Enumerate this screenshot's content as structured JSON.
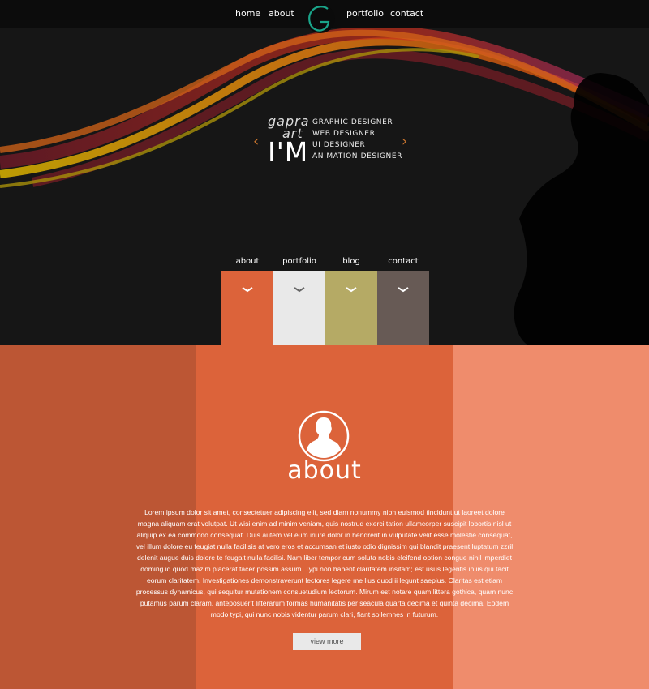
{
  "top_nav": {
    "items": [
      {
        "label": "home"
      },
      {
        "label": "about"
      },
      {
        "label": "portfolio"
      },
      {
        "label": "contact"
      }
    ],
    "logo_letter": "G"
  },
  "hero": {
    "brand_small_line1": "gapra",
    "brand_small_line2": "art",
    "brand_big": "I'M",
    "roles": [
      "GRAPHIC DESIGNER",
      "WEB DESIGNER",
      "UI DESIGNER",
      "ANIMATION DESIGNER"
    ],
    "prev_arrow": "‹",
    "next_arrow": "›"
  },
  "sections": [
    {
      "label": "about",
      "color": "#dc633a"
    },
    {
      "label": "portfolio",
      "color": "#e9e9e9"
    },
    {
      "label": "blog",
      "color": "#b5aa65"
    },
    {
      "label": "contact",
      "color": "#675a55"
    }
  ],
  "about": {
    "title": "about",
    "body": "Lorem ipsum dolor sit amet, consectetuer adipiscing elit, sed diam nonummy nibh euismod tincidunt ut laoreet dolore magna aliquam erat volutpat. Ut wisi enim ad minim veniam, quis nostrud exerci tation ullamcorper suscipit lobortis nisl ut aliquip ex ea commodo consequat. Duis autem vel eum iriure dolor in hendrerit in vulputate velit esse molestie consequat, vel illum dolore eu feugiat nulla facilisis at vero eros et accumsan et iusto odio dignissim qui blandit praesent luptatum zzril delenit augue duis dolore te feugait nulla facilisi. Nam liber tempor cum soluta nobis eleifend option congue nihil imperdiet doming id quod mazim placerat facer possim assum. Typi non habent claritatem insitam; est usus legentis in iis qui facit eorum claritatem. Investigationes demonstraverunt lectores legere me lius quod ii legunt saepius. Claritas est etiam processus dynamicus, qui sequitur mutationem consuetudium lectorum. Mirum est notare quam littera gothica, quam nunc putamus parum claram, anteposuerit litterarum formas humanitatis per seacula quarta decima et quinta decima. Eodem modo typi, qui nunc nobis videntur parum clari, fiant sollemnes in futurum.",
    "button": "view more"
  },
  "colors": {
    "accent": "#1aa58a",
    "orange_dark": "#bc5634",
    "orange": "#dc633a",
    "orange_light": "#ef8c6c"
  }
}
